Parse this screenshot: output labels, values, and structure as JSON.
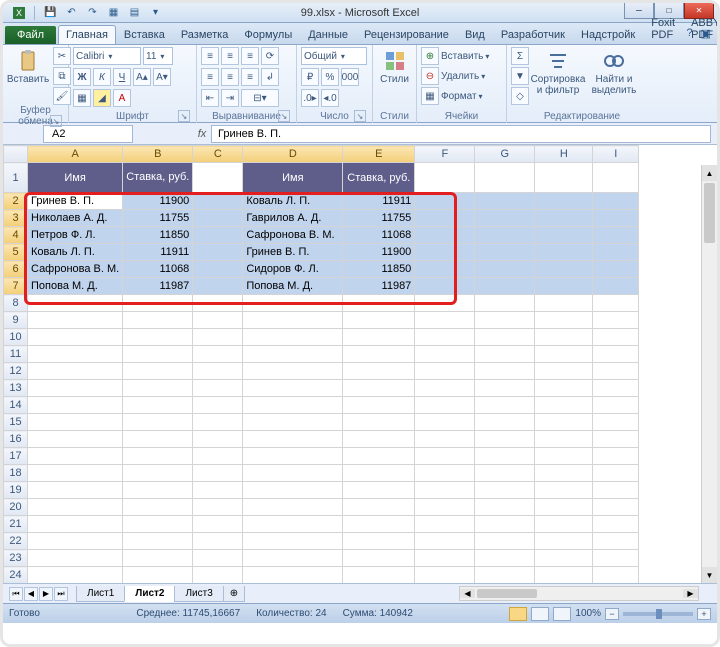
{
  "window": {
    "title": "99.xlsx - Microsoft Excel",
    "min_glyph": "─",
    "max_glyph": "□",
    "close_glyph": "✕"
  },
  "qat": {
    "save": "💾",
    "undo": "↶",
    "redo": "↷",
    "extra1": "▦",
    "extra2": "▤",
    "dd": "▾"
  },
  "tabs": {
    "file": "Файл",
    "home": "Главная",
    "insert": "Вставка",
    "layout": "Разметка",
    "formulas": "Формулы",
    "data": "Данные",
    "review": "Рецензирование",
    "view": "Вид",
    "developer": "Разработчик",
    "addins": "Надстройк",
    "foxit": "Foxit PDF",
    "abbyy": "ABBYY PDF"
  },
  "ribbon": {
    "clipboard": {
      "paste": "Вставить",
      "label": "Буфер обмена"
    },
    "font": {
      "name": "Calibri",
      "size": "11",
      "label": "Шрифт",
      "bold": "Ж",
      "italic": "К",
      "underline": "Ч"
    },
    "align": {
      "label": "Выравнивание"
    },
    "number": {
      "general": "Общий",
      "label": "Число",
      "pct": "%",
      "comma": "000"
    },
    "styles": {
      "btn": "Стили",
      "label": "Стили"
    },
    "cells": {
      "insert": "Вставить",
      "delete": "Удалить",
      "format": "Формат",
      "label": "Ячейки"
    },
    "editing": {
      "sort": "Сортировка и фильтр",
      "find": "Найти и выделить",
      "label": "Редактирование"
    }
  },
  "namebox": "A2",
  "formula": "Гринев В. П.",
  "fx": "fx",
  "cols": [
    "A",
    "B",
    "C",
    "D",
    "E",
    "F",
    "G",
    "H",
    "I"
  ],
  "colW": {
    "A": 95,
    "B": 60,
    "C": 50,
    "D": 100,
    "E": 72,
    "F": 60,
    "G": 60,
    "H": 58,
    "I": 46
  },
  "rows_visible": 24,
  "header_row": {
    "A": "Имя",
    "B": "Ставка, руб.",
    "D": "Имя",
    "E": "Ставка, руб."
  },
  "data_left": [
    {
      "name": "Гринев В. П.",
      "rate": "11900"
    },
    {
      "name": "Николаев А. Д.",
      "rate": "11755"
    },
    {
      "name": "Петров Ф. Л.",
      "rate": "11850"
    },
    {
      "name": "Коваль Л. П.",
      "rate": "11911"
    },
    {
      "name": "Сафронова В. М.",
      "rate": "11068"
    },
    {
      "name": "Попова М. Д.",
      "rate": "11987"
    }
  ],
  "data_right": [
    {
      "name": "Коваль Л. П.",
      "rate": "11911"
    },
    {
      "name": "Гаврилов А. Д.",
      "rate": "11755"
    },
    {
      "name": "Сафронова В. М.",
      "rate": "11068"
    },
    {
      "name": "Гринев В. П.",
      "rate": "11900"
    },
    {
      "name": "Сидоров Ф. Л.",
      "rate": "11850"
    },
    {
      "name": "Попова М. Д.",
      "rate": "11987"
    }
  ],
  "sheets": {
    "s1": "Лист1",
    "s2": "Лист2",
    "s3": "Лист3",
    "new": "⊕"
  },
  "status": {
    "ready": "Готово",
    "avg_label": "Среднее:",
    "avg": "11745,16667",
    "count_label": "Количество:",
    "count": "24",
    "sum_label": "Сумма:",
    "sum": "140942",
    "zoom": "100%",
    "minus": "−",
    "plus": "+"
  }
}
